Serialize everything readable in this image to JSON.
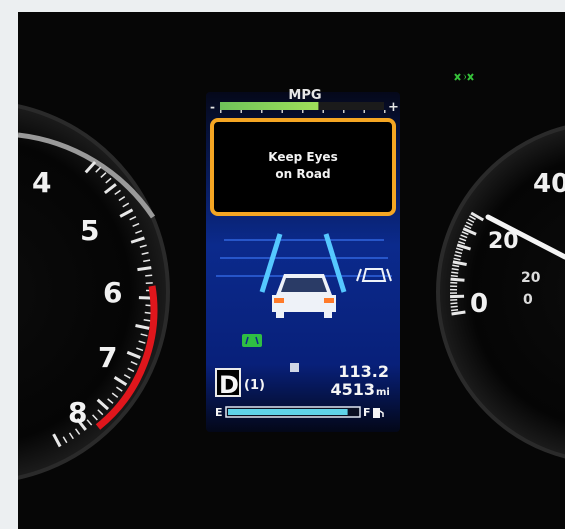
{
  "tachometer": {
    "numbers": [
      "4",
      "5",
      "6",
      "7",
      "8"
    ],
    "redline_color": "#e0161c"
  },
  "speedometer": {
    "numbers": [
      "40",
      "20",
      "0"
    ],
    "sub_numbers": [
      "20",
      "0"
    ]
  },
  "indicator_icons": {
    "headlight": "headlight-icon",
    "lane_assist": "lane-keep-icon"
  },
  "display": {
    "mpg_label": "MPG",
    "mpg_minus": "-",
    "mpg_plus": "+",
    "mpg_level": 0.6,
    "warning_line1": "Keep Eyes",
    "warning_line2": "on Road",
    "gear": "D",
    "gear_sub": "(1)",
    "trip": "113.2",
    "odometer_value": "4513",
    "odometer_unit": "mi",
    "fuel_empty_label": "E",
    "fuel_full_label": "F",
    "fuel_level": 0.92,
    "accent_color": "#f5a623",
    "screen_color": "#0b2a8c"
  }
}
